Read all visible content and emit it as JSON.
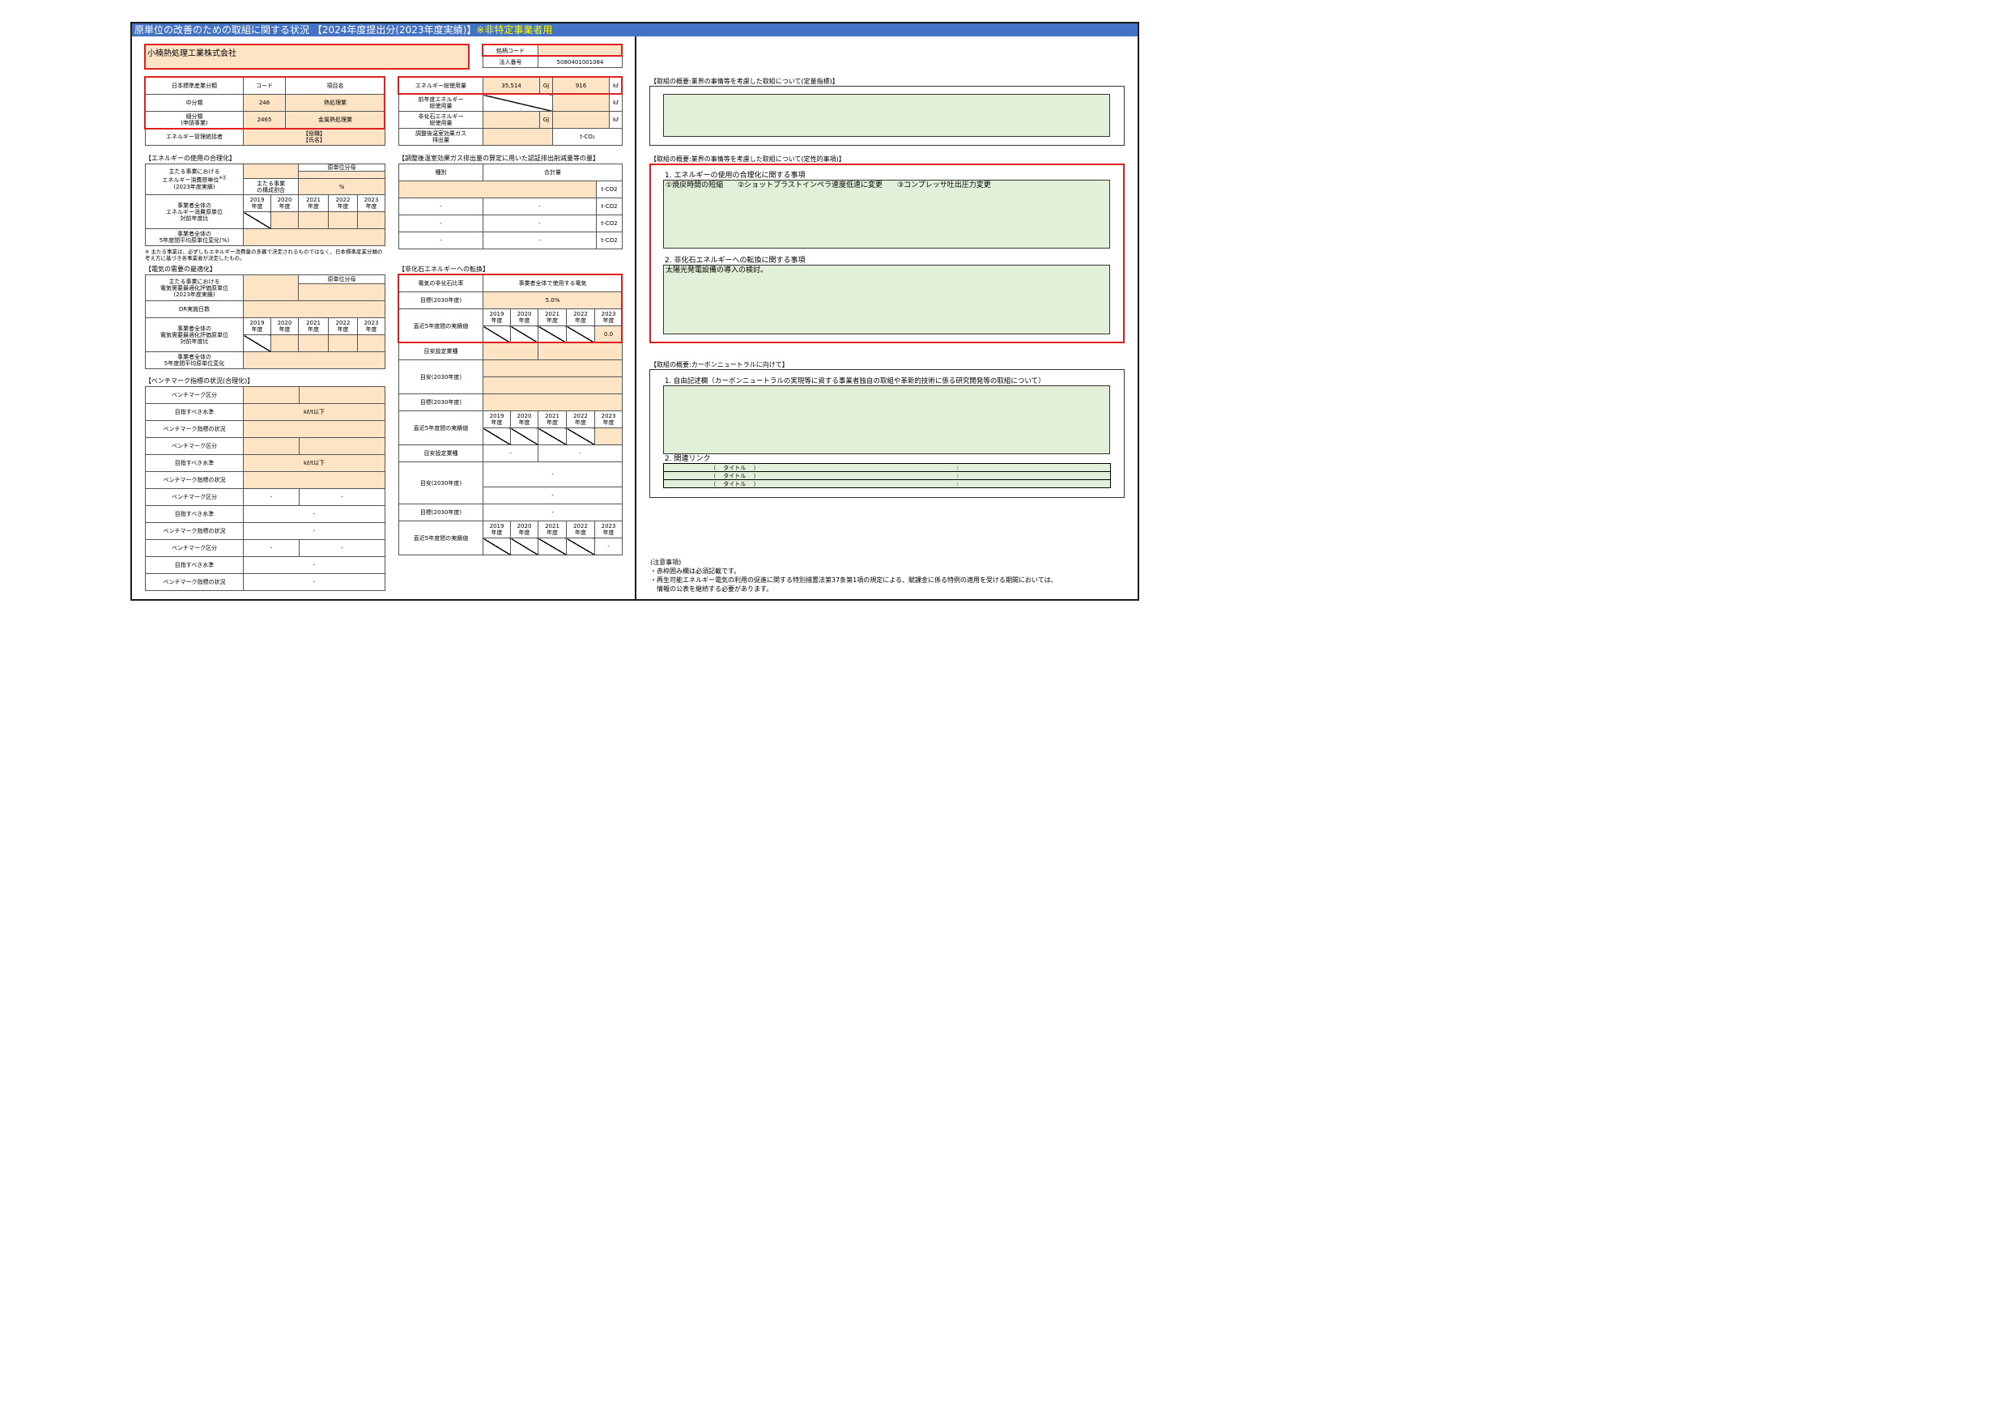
{
  "title_main": "原単位の改善のための取組に関する状況 【2024年度提出分(2023年度実績)】",
  "title_highlight": "※非特定事業者用",
  "company": {
    "name": "小楠熱処理工業株式会社",
    "stock_code_label": "銘柄コード",
    "stock_code_value": "",
    "corp_no_label": "法人番号",
    "corp_no_value": "5080401001084"
  },
  "industry": {
    "header": [
      "日本標準産業分類",
      "コード",
      "項目名"
    ],
    "middle_label": "中分類",
    "middle_code": "246",
    "middle_name": "熱処理業",
    "small_label_1": "細分類",
    "small_label_2": "(申請事業)",
    "small_code": "2465",
    "small_name": "金属熱処理業",
    "manager_label": "エネルギー管理統括者",
    "manager_role": "【役職】",
    "manager_name": "【氏名】"
  },
  "energy": {
    "total_label": "エネルギー総使用量",
    "total_gj": "35,514",
    "unit_gj": "GJ",
    "total_kl": "916",
    "unit_kl": "kℓ",
    "prev_label_1": "前年度エネルギー",
    "prev_label_2": "総使用量",
    "nonfossil_label_1": "非化石エネルギー",
    "nonfossil_label_2": "総使用量",
    "ghg_label_1": "調整後温室効果ガス",
    "ghg_label_2": "排出量",
    "unit_tco2": "t-CO₂"
  },
  "rationalization": {
    "section": "【エネルギーの使用の合理化】",
    "main_label_1": "主たる事業における",
    "main_label_2": "エネルギー消費原単位",
    "main_label_sup": "※注",
    "main_label_3": "(2023年度実績)",
    "denominator": "原単位分母",
    "ratio_label_1": "主たる事業",
    "ratio_label_2": "の構成割合",
    "unit_pct": "%",
    "years": [
      "2019",
      "2020",
      "2021",
      "2022",
      "2023"
    ],
    "nendo": "年度",
    "yoy_label_1": "事業者全体の",
    "yoy_label_2": "エネルギー消費原単位",
    "yoy_label_3": "対前年度比",
    "avg_label_1": "事業者全体の",
    "avg_label_2": "5年度間平均原単位変化(%)",
    "note": "※ 主たる事業は、必ずしもエネルギー消費量の多寡で決定されるものではなく、日本標準産業分類の考え方に基づき各事業者が決定したもの。"
  },
  "electricity": {
    "section": "【電気の需要の最適化】",
    "main_label_1": "主たる事業における",
    "main_label_2": "電気需要最適化評価原単位",
    "main_label_3": "(2023年度実績)",
    "denominator": "原単位分母",
    "dr_label": "DR実施日数",
    "yoy_label_1": "事業者全体の",
    "yoy_label_2": "電気需要最適化評価原単位",
    "yoy_label_3": "対前年度比",
    "avg_label_1": "事業者全体の",
    "avg_label_2": "5年度間平均原単位変化"
  },
  "benchmark": {
    "section": "【ベンチマーク指標の状況(合理化)】",
    "category": "ベンチマーク区分",
    "target": "目指すべき水準",
    "status": "ベンチマーク指標の状況",
    "unit_kl_t": "kℓ/t以下",
    "dash": "-"
  },
  "credits": {
    "section": "【調整後温室効果ガス排出量の算定に用いた認証排出削減量等の量】",
    "header": [
      "種別",
      "合計量"
    ],
    "unit": "t-CO2",
    "dash": "-"
  },
  "nonfossil": {
    "section": "【非化石エネルギーへの転換】",
    "ratio_label": "電気の非化石比率",
    "scope_label": "事業者全体で使用する電気",
    "target_label": "目標(2030年度)",
    "target_value": "5.0%",
    "actual_label": "直近5年度間の実績値",
    "actual_2023": "0.0",
    "setting_label": "目安設定業種",
    "guide_label": "目安(2030年度)",
    "dash": "-"
  },
  "right": {
    "quant_section": "【取組の概要:業界の事情等を考慮した取組について(定量指標)】",
    "qual_section": "【取組の概要:業界の事情等を考慮した取組について(定性的事項)】",
    "qual_item1_title": "1. エネルギーの使用の合理化に関する事項",
    "qual_item1_text": "①焼戻時間の短縮　　②ショットブラストインペラ速度低速に変更　　③コンプレッサ吐出圧力変更",
    "qual_item2_title": "2. 非化石エネルギーへの転換に関する事項",
    "qual_item2_text": "太陽光発電設備の導入の検討。",
    "cn_section": "【取組の概要:カーボンニュートラルに向けて】",
    "cn_item1_title": "1. 自由記述欄（カーボンニュートラルの実現等に資する事業者独自の取組や革新的技術に係る研究開発等の取組について）",
    "cn_item2_title": "2. 関連リンク",
    "links": [
      "（　 タイトル　 ）",
      "（　 タイトル　 ）",
      "（　 タイトル　 ）"
    ],
    "link_sep": ":",
    "notes_title": "(注意事項)",
    "notes": [
      "・赤枠囲み欄は必須記載です。",
      "・再生可能エネルギー電気の利用の促進に関する特別措置法第37条第1項の規定による、賦課金に係る特例の適用を受ける期間においては、",
      "　情報の公表を継続する必要があります。"
    ]
  },
  "colors": {
    "title_bar": "#4472c4",
    "title_highlight": "#ffff00",
    "input_cell": "#fce4c4",
    "free_text": "#e2efd9",
    "required_frame": "#e02020"
  }
}
